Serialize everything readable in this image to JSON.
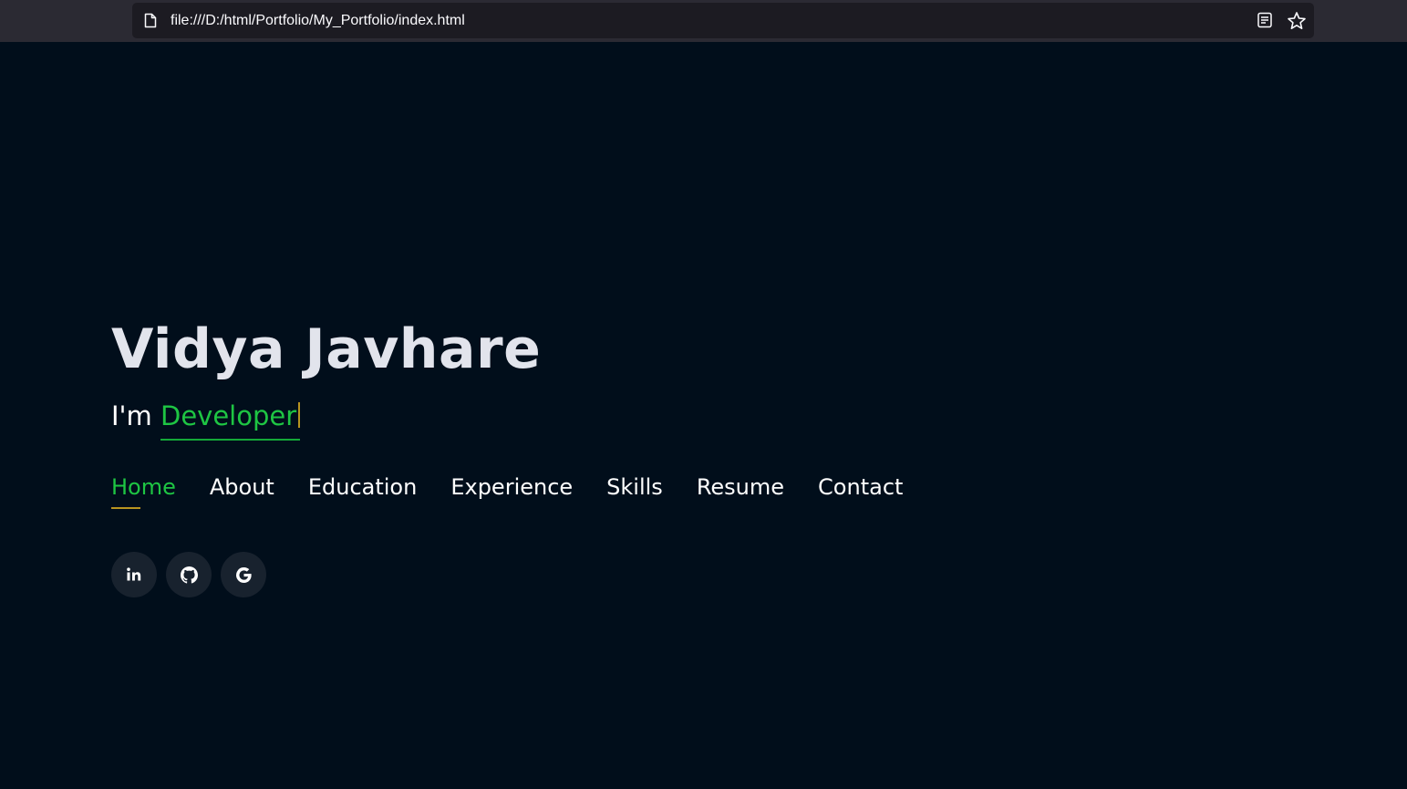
{
  "browser": {
    "url": "file:///D:/html/Portfolio/My_Portfolio/index.html",
    "icons": [
      "page-icon",
      "reader-view-icon",
      "bookmark-star-icon"
    ]
  },
  "hero": {
    "name": "Vidya Javhare",
    "tagline_prefix": "I'm ",
    "typed_role": "Developer"
  },
  "nav": {
    "items": [
      {
        "label": "Home",
        "active": true
      },
      {
        "label": "About",
        "active": false
      },
      {
        "label": "Education",
        "active": false
      },
      {
        "label": "Experience",
        "active": false
      },
      {
        "label": "Skills",
        "active": false
      },
      {
        "label": "Resume",
        "active": false
      },
      {
        "label": "Contact",
        "active": false
      }
    ]
  },
  "social": {
    "icons": [
      "linkedin-icon",
      "github-icon",
      "google-icon"
    ]
  },
  "colors": {
    "background": "#010e1b",
    "accent": "#1ec543",
    "underline": "#b89420",
    "heading": "#e2e4ec",
    "social_button": "#18222e"
  }
}
